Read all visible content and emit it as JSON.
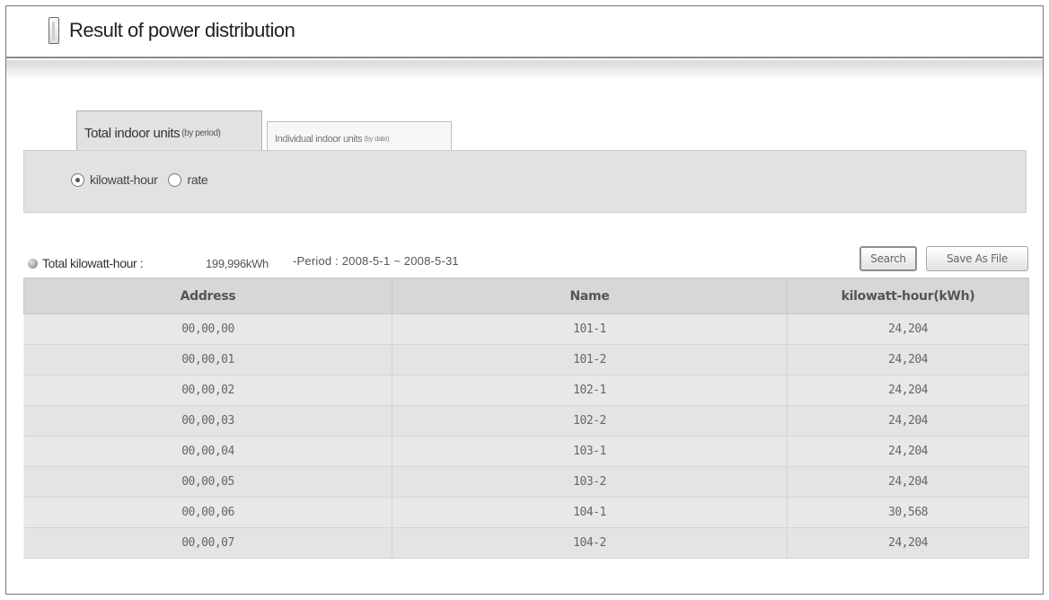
{
  "page": {
    "title": "Result of power distribution"
  },
  "tabs": [
    {
      "label": "Total indoor units",
      "sub": "(by period)",
      "active": true
    },
    {
      "label": "Individual indoor units",
      "sub": "(by date)",
      "active": false
    }
  ],
  "options": {
    "radios": [
      {
        "label": "kilowatt-hour",
        "checked": true
      },
      {
        "label": "rate",
        "checked": false
      }
    ]
  },
  "summary": {
    "label": "Total kilowatt-hour :",
    "value": "199,996kWh",
    "period": "-Period : 2008-5-1 ~ 2008-5-31"
  },
  "buttons": {
    "search": "Search",
    "save": "Save As File"
  },
  "table": {
    "columns": [
      "Address",
      "Name",
      "kilowatt-hour(kWh)"
    ],
    "rows": [
      [
        "00,00,00",
        "101-1",
        "24,204"
      ],
      [
        "00,00,01",
        "101-2",
        "24,204"
      ],
      [
        "00,00,02",
        "102-1",
        "24,204"
      ],
      [
        "00,00,03",
        "102-2",
        "24,204"
      ],
      [
        "00,00,04",
        "103-1",
        "24,204"
      ],
      [
        "00,00,05",
        "103-2",
        "24,204"
      ],
      [
        "00,00,06",
        "104-1",
        "30,568"
      ],
      [
        "00,00,07",
        "104-2",
        "24,204"
      ]
    ]
  }
}
